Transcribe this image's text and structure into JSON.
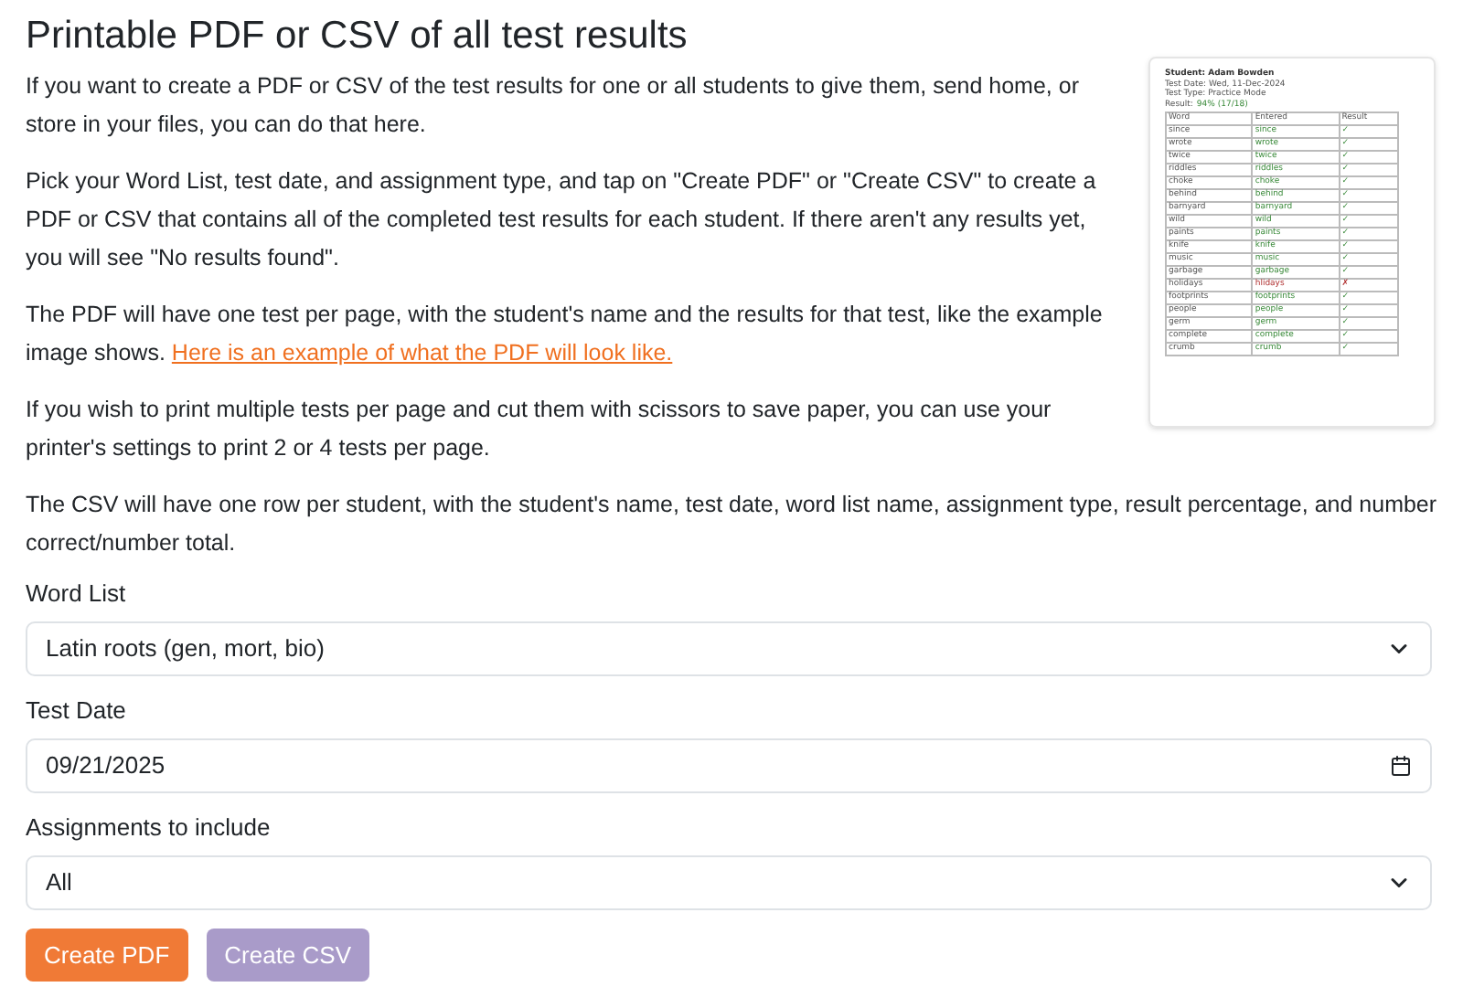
{
  "title": "Printable PDF or CSV of all test results",
  "intro": [
    {
      "text": "If you want to create a PDF or CSV of the test results for one or all students to give them, send home, or store in your files, you can do that here."
    },
    {
      "text": "Pick your Word List, test date, and assignment type, and tap on \"Create PDF\" or \"Create CSV\" to create a PDF or CSV that contains all of the completed test results for each student. If there aren't any results yet, you will see \"No results found\"."
    },
    {
      "text": "The PDF will have one test per page, with the student's name and the results for that test, like the example image shows.",
      "link": "Here is an example of what the PDF will look like."
    },
    {
      "text": "If you wish to print multiple tests per page and cut them with scissors to save paper, you can use your printer's settings to print 2 or 4 tests per page."
    }
  ],
  "csv_note": "The CSV will have one row per student, with the student's name, test date, word list name, assignment type, result percentage, and number correct/number total.",
  "example": {
    "student": "Student: Adam Bowden",
    "date": "Test Date: Wed, 11-Dec-2024",
    "type": "Test Type: Practice Mode",
    "result_label": "Result:",
    "result": "94% (17/18)",
    "columns": [
      "Word",
      "Entered",
      "Result"
    ],
    "rows": [
      {
        "word": "since",
        "entered": "since",
        "mark": "✓",
        "correct": true
      },
      {
        "word": "wrote",
        "entered": "wrote",
        "mark": "✓",
        "correct": true
      },
      {
        "word": "twice",
        "entered": "twice",
        "mark": "✓",
        "correct": true
      },
      {
        "word": "riddles",
        "entered": "riddles",
        "mark": "✓",
        "correct": true
      },
      {
        "word": "choke",
        "entered": "choke",
        "mark": "✓",
        "correct": true
      },
      {
        "word": "behind",
        "entered": "behind",
        "mark": "✓",
        "correct": true
      },
      {
        "word": "barnyard",
        "entered": "barnyard",
        "mark": "✓",
        "correct": true
      },
      {
        "word": "wild",
        "entered": "wild",
        "mark": "✓",
        "correct": true
      },
      {
        "word": "paints",
        "entered": "paints",
        "mark": "✓",
        "correct": true
      },
      {
        "word": "knife",
        "entered": "knife",
        "mark": "✓",
        "correct": true
      },
      {
        "word": "music",
        "entered": "music",
        "mark": "✓",
        "correct": true
      },
      {
        "word": "garbage",
        "entered": "garbage",
        "mark": "✓",
        "correct": true
      },
      {
        "word": "holidays",
        "entered": "hlidays",
        "mark": "✗",
        "correct": false
      },
      {
        "word": "footprints",
        "entered": "footprints",
        "mark": "✓",
        "correct": true
      },
      {
        "word": "people",
        "entered": "people",
        "mark": "✓",
        "correct": true
      },
      {
        "word": "germ",
        "entered": "germ",
        "mark": "✓",
        "correct": true
      },
      {
        "word": "complete",
        "entered": "complete",
        "mark": "✓",
        "correct": true
      },
      {
        "word": "crumb",
        "entered": "crumb",
        "mark": "✓",
        "correct": true
      }
    ]
  },
  "fields": [
    {
      "label": "Word List",
      "kind": "select",
      "value": "Latin roots (gen, mort, bio)"
    },
    {
      "label": "Test Date",
      "kind": "date",
      "value": "09/21/2025"
    },
    {
      "label": "Assignments to include",
      "kind": "select",
      "value": "All"
    }
  ],
  "buttons": [
    {
      "label": "Create PDF",
      "disabled": false
    },
    {
      "label": "Create CSV",
      "disabled": true
    }
  ]
}
